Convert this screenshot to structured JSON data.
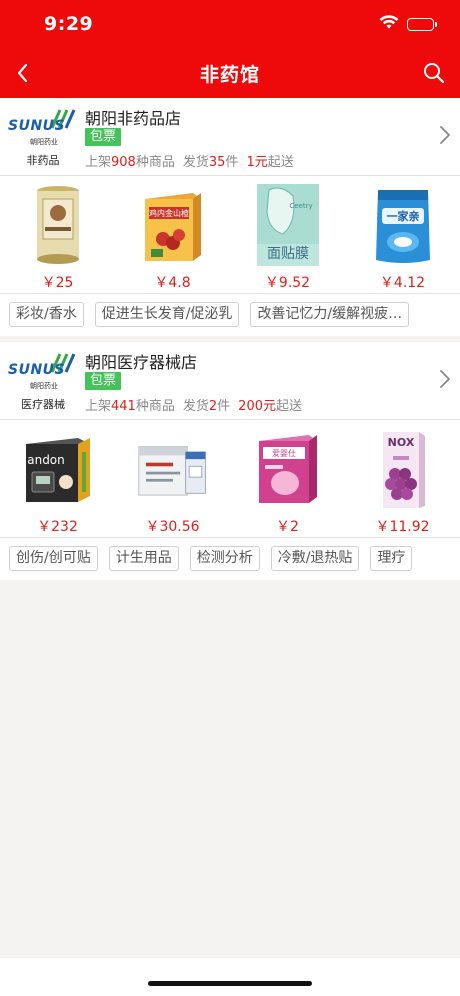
{
  "status_bar": {
    "time": "9:29"
  },
  "nav": {
    "title": "非药馆"
  },
  "stores": [
    {
      "logo_word": "SUNUS",
      "logo_sub": "朝阳药业",
      "category": "非药品",
      "name": "朝阳非药品店",
      "badge": "包票",
      "stats": {
        "listed_prefix": "上架",
        "listed_count": "908",
        "listed_suffix": "种商品",
        "ship_prefix": "发货",
        "ship_count": "35",
        "ship_suffix": "件",
        "min_amount": "1元",
        "min_suffix": "起送"
      },
      "products": [
        {
          "price": "￥25",
          "icon": "can-icon",
          "color": "#d8c889"
        },
        {
          "price": "￥4.8",
          "icon": "hawthorn-box-icon",
          "color": "#c8352a"
        },
        {
          "price": "￥9.52",
          "icon": "face-mask-pack-icon",
          "color": "#8fd1c6",
          "text": "面贴膜"
        },
        {
          "price": "￥4.12",
          "icon": "detergent-pouch-icon",
          "color": "#1f7fc4",
          "text": "一家亲"
        }
      ],
      "tags": [
        "彩妆/香水",
        "促进生长发育/促泌乳",
        "改善记忆力/缓解视疲…"
      ]
    },
    {
      "logo_word": "SUNUS",
      "logo_sub": "朝阳药业",
      "category": "医疗器械",
      "name": "朝阳医疗器械店",
      "badge": "包票",
      "stats": {
        "listed_prefix": "上架",
        "listed_count": "441",
        "listed_suffix": "种商品",
        "ship_prefix": "发货",
        "ship_count": "2",
        "ship_suffix": "件",
        "min_amount": "200元",
        "min_suffix": "起送"
      },
      "products": [
        {
          "price": "￥232",
          "icon": "blood-pressure-monitor-icon",
          "color": "#222222",
          "text": "andon"
        },
        {
          "price": "￥30.56",
          "icon": "test-strips-icon",
          "color": "#9aa3b0"
        },
        {
          "price": "￥2",
          "icon": "pink-box-icon",
          "color": "#d1418e"
        },
        {
          "price": "￥11.92",
          "icon": "grape-box-icon",
          "color": "#9b3f8f",
          "text": "NOX"
        }
      ],
      "tags": [
        "创伤/创可贴",
        "计生用品",
        "检测分析",
        "冷敷/退热贴",
        "理疗"
      ]
    }
  ],
  "colors": {
    "brand_red": "#ee0a0a",
    "price_red": "#e0201c",
    "badge_green": "#43c35a"
  }
}
